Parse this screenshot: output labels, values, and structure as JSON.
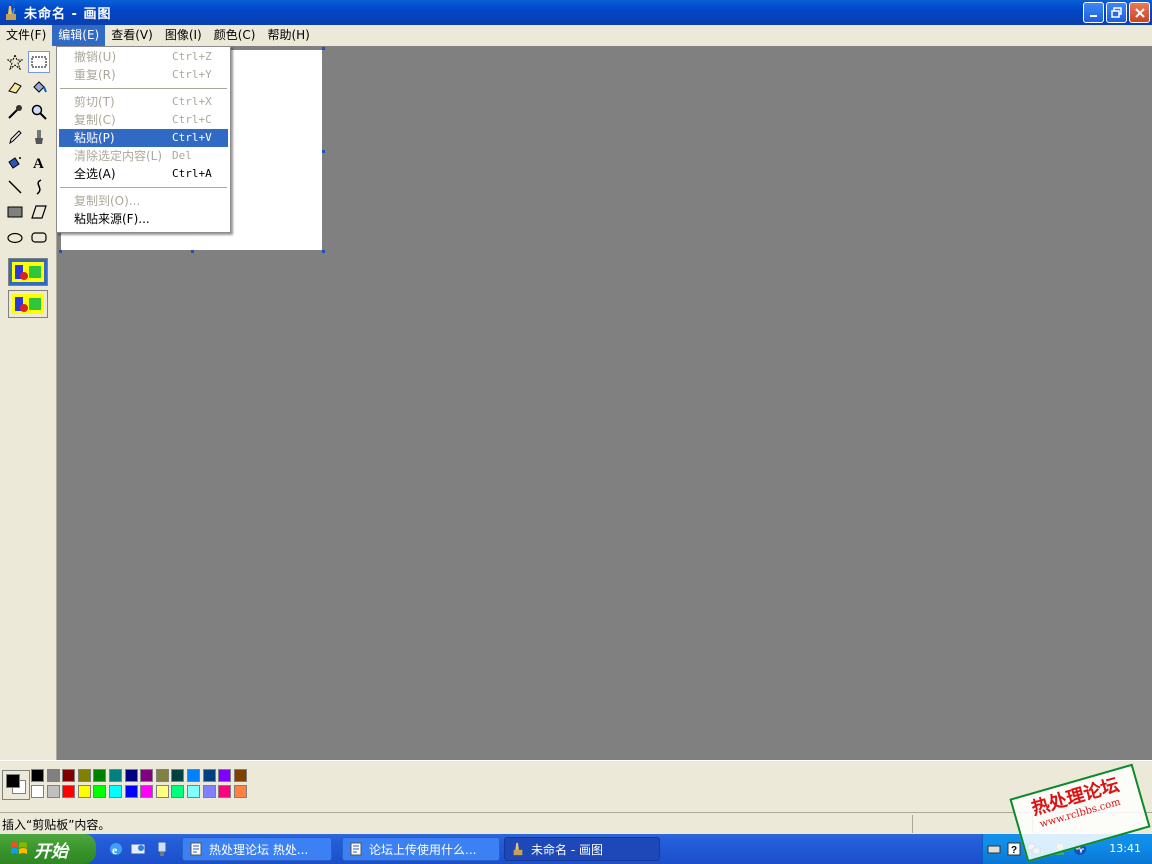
{
  "window": {
    "title": "未命名 - 画图",
    "icon": "paint-brush-icon"
  },
  "menubar": {
    "items": [
      {
        "label": "文件(F)"
      },
      {
        "label": "编辑(E)"
      },
      {
        "label": "查看(V)"
      },
      {
        "label": "图像(I)"
      },
      {
        "label": "颜色(C)"
      },
      {
        "label": "帮助(H)"
      }
    ]
  },
  "edit_menu": {
    "items": [
      {
        "label": "撤销(U)",
        "shortcut": "Ctrl+Z",
        "enabled": false
      },
      {
        "label": "重复(R)",
        "shortcut": "Ctrl+Y",
        "enabled": false
      },
      {
        "label": "剪切(T)",
        "shortcut": "Ctrl+X",
        "enabled": false
      },
      {
        "label": "复制(C)",
        "shortcut": "Ctrl+C",
        "enabled": false
      },
      {
        "label": "粘贴(P)",
        "shortcut": "Ctrl+V",
        "enabled": true,
        "highlighted": true
      },
      {
        "label": "清除选定内容(L)",
        "shortcut": "Del",
        "enabled": false
      },
      {
        "label": "全选(A)",
        "shortcut": "Ctrl+A",
        "enabled": true
      },
      {
        "label": "复制到(O)...",
        "shortcut": "",
        "enabled": false
      },
      {
        "label": "粘贴来源(F)...",
        "shortcut": "",
        "enabled": true
      }
    ]
  },
  "tools": [
    "free-select-icon",
    "rect-select-icon",
    "eraser-icon",
    "fill-icon",
    "color-picker-icon",
    "magnifier-icon",
    "pencil-icon",
    "brush-icon",
    "airbrush-icon",
    "text-icon",
    "line-icon",
    "curve-icon",
    "rectangle-icon",
    "polygon-icon",
    "ellipse-icon",
    "rounded-rect-icon"
  ],
  "palette": {
    "foreground": "#000000",
    "background": "#ffffff",
    "top_row": [
      "#000000",
      "#808080",
      "#800000",
      "#808000",
      "#008000",
      "#008080",
      "#000080",
      "#800080",
      "#808040",
      "#004040",
      "#0080ff",
      "#004080",
      "#8000ff",
      "#804000"
    ],
    "bottom_row": [
      "#ffffff",
      "#c0c0c0",
      "#ff0000",
      "#ffff00",
      "#00ff00",
      "#00ffff",
      "#0000ff",
      "#ff00ff",
      "#ffff80",
      "#00ff80",
      "#80ffff",
      "#8080ff",
      "#ff0080",
      "#ff8040"
    ]
  },
  "statusbar": {
    "text": "插入“剪贴板”内容。"
  },
  "taskbar": {
    "start_label": "开始",
    "tasks": [
      {
        "label": "热处理论坛 热处..."
      },
      {
        "label": "论坛上传使用什么..."
      },
      {
        "label": "未命名 - 画图",
        "active": true
      }
    ],
    "clock": "13:41"
  },
  "watermark": {
    "line1": "热处理论坛",
    "line2": "www.rclbbs.com"
  }
}
